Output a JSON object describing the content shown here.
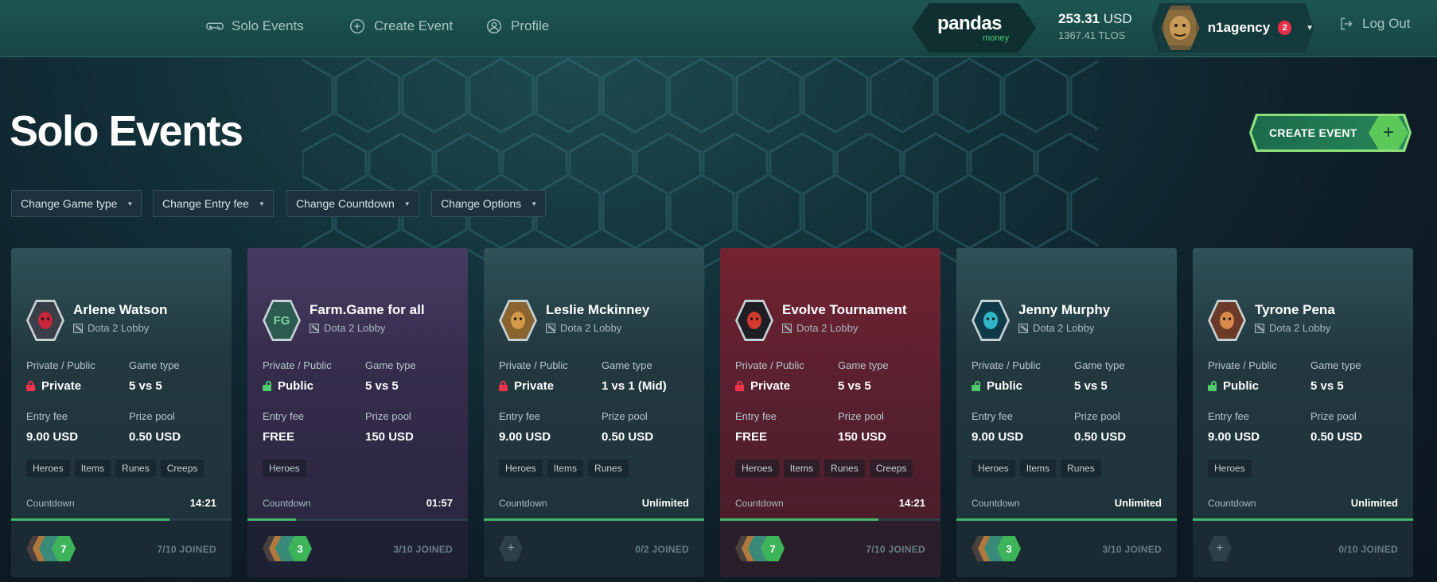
{
  "nav": {
    "items": [
      {
        "label": "Solo Events",
        "icon": "gamepad-icon"
      },
      {
        "label": "Create Event",
        "icon": "plus-circle-icon"
      },
      {
        "label": "Profile",
        "icon": "user-icon"
      }
    ]
  },
  "brand": {
    "name": "pandas",
    "sub": "money"
  },
  "balance": {
    "primary_amount": "253.31",
    "primary_currency": "USD",
    "secondary": "1367.41 TLOS"
  },
  "user": {
    "name": "n1agency",
    "notifications": "2"
  },
  "logout": {
    "label": "Log Out"
  },
  "page": {
    "title": "Solo Events",
    "create_button": "CREATE EVENT"
  },
  "filters": [
    "Change Game type",
    "Change Entry fee",
    "Change Countdown",
    "Change Options"
  ],
  "labels": {
    "privacy": "Private / Public",
    "game_type": "Game type",
    "entry_fee": "Entry fee",
    "prize_pool": "Prize pool",
    "countdown": "Countdown"
  },
  "colors": {
    "accent_green": "#45b86a",
    "private_red": "#f0334d",
    "public_green": "#4fc96a"
  },
  "events": [
    {
      "name": "Arlene Watson",
      "game": "Dota 2 Lobby",
      "privacy": "Private",
      "game_type": "5 vs 5",
      "entry_fee": "9.00 USD",
      "prize_pool": "0.50 USD",
      "tags": [
        "Heroes",
        "Items",
        "Runes",
        "Creeps"
      ],
      "countdown": "14:21",
      "progress": 0.72,
      "joined": "7/10 JOINED",
      "joined_extra": "7",
      "theme": "teal"
    },
    {
      "name": "Farm.Game for all",
      "game": "Dota 2 Lobby",
      "privacy": "Public",
      "game_type": "5 vs 5",
      "entry_fee": "FREE",
      "prize_pool": "150 USD",
      "tags": [
        "Heroes"
      ],
      "countdown": "01:57",
      "progress": 0.22,
      "joined": "3/10 JOINED",
      "joined_extra": "3",
      "theme": "purple",
      "avatar_text": "FG"
    },
    {
      "name": "Leslie Mckinney",
      "game": "Dota 2 Lobby",
      "privacy": "Private",
      "game_type": "1 vs 1 (Mid)",
      "entry_fee": "9.00 USD",
      "prize_pool": "0.50 USD",
      "tags": [
        "Heroes",
        "Items",
        "Runes"
      ],
      "countdown": "Unlimited",
      "progress": 1.0,
      "joined": "0/2 JOINED",
      "joined_extra": "",
      "theme": "teal"
    },
    {
      "name": "Evolve Tournament",
      "game": "Dota 2 Lobby",
      "privacy": "Private",
      "game_type": "5 vs 5",
      "entry_fee": "FREE",
      "prize_pool": "150 USD",
      "tags": [
        "Heroes",
        "Items",
        "Runes",
        "Creeps"
      ],
      "countdown": "14:21",
      "progress": 0.72,
      "joined": "7/10 JOINED",
      "joined_extra": "7",
      "theme": "red"
    },
    {
      "name": "Jenny Murphy",
      "game": "Dota 2 Lobby",
      "privacy": "Public",
      "game_type": "5 vs 5",
      "entry_fee": "9.00 USD",
      "prize_pool": "0.50 USD",
      "tags": [
        "Heroes",
        "Items",
        "Runes"
      ],
      "countdown": "Unlimited",
      "progress": 1.0,
      "joined": "3/10 JOINED",
      "joined_extra": "3",
      "theme": "teal"
    },
    {
      "name": "Tyrone Pena",
      "game": "Dota 2 Lobby",
      "privacy": "Public",
      "game_type": "5 vs 5",
      "entry_fee": "9.00 USD",
      "prize_pool": "0.50 USD",
      "tags": [
        "Heroes"
      ],
      "countdown": "Unlimited",
      "progress": 1.0,
      "joined": "0/10 JOINED",
      "joined_extra": "",
      "theme": "teal"
    }
  ]
}
